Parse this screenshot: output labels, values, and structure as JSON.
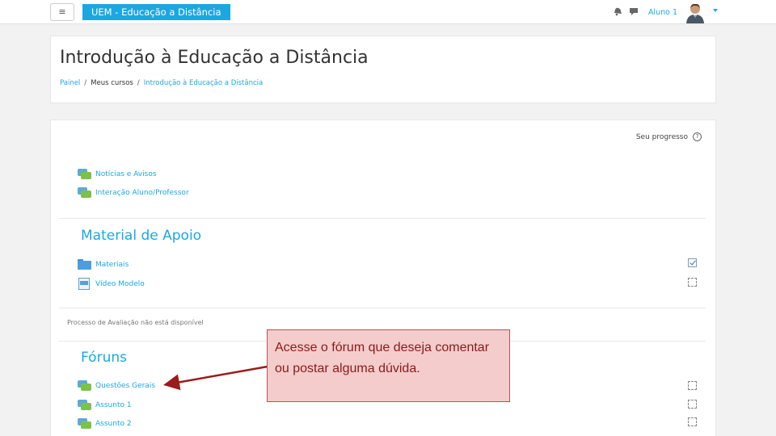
{
  "navbar": {
    "menu_icon": "hamburger-icon",
    "menu_glyph": "≡",
    "site_name": "UEM - Educação a Distância",
    "notification_icon": "bell-icon",
    "message_icon": "chat-icon",
    "user_name": "Aluno 1",
    "brand_color": "#1ba8e0"
  },
  "header": {
    "title": "Introdução à Educação a Distância",
    "breadcrumb": [
      {
        "label": "Painel",
        "link": true
      },
      {
        "label": "/",
        "link": false
      },
      {
        "label": "Meus cursos",
        "link": false
      },
      {
        "label": "/",
        "link": false
      },
      {
        "label": "Introdução à Educação a Distância",
        "link": true
      }
    ]
  },
  "content": {
    "progress_label": "Seu progresso",
    "progress_help_glyph": "?",
    "general_activities": [
      {
        "label": "Notícias e Avisos",
        "icon": "forum-icon"
      },
      {
        "label": "Interação Aluno/Professor",
        "icon": "forum-icon"
      }
    ],
    "section_material": {
      "title": "Material de Apoio",
      "items": [
        {
          "label": "Materiais",
          "icon": "folder-icon",
          "completed": true
        },
        {
          "label": "Vídeo Modelo",
          "icon": "video-icon",
          "completed": false
        }
      ]
    },
    "notice": "Processo de Avaliação não está disponível",
    "section_forums": {
      "title": "Fóruns",
      "items": [
        {
          "label": "Questões Gerais",
          "icon": "forum-icon",
          "completed": false
        },
        {
          "label": "Assunto 1",
          "icon": "forum-icon",
          "completed": false
        },
        {
          "label": "Assunto 2",
          "icon": "forum-icon",
          "completed": false
        }
      ]
    }
  },
  "callout": {
    "text": "Acesse o fórum que deseja comentar ou postar alguma dúvida.",
    "background": "#f4cccc",
    "text_color": "#8b1a1a",
    "arrow_color": "#9b1c1c"
  }
}
